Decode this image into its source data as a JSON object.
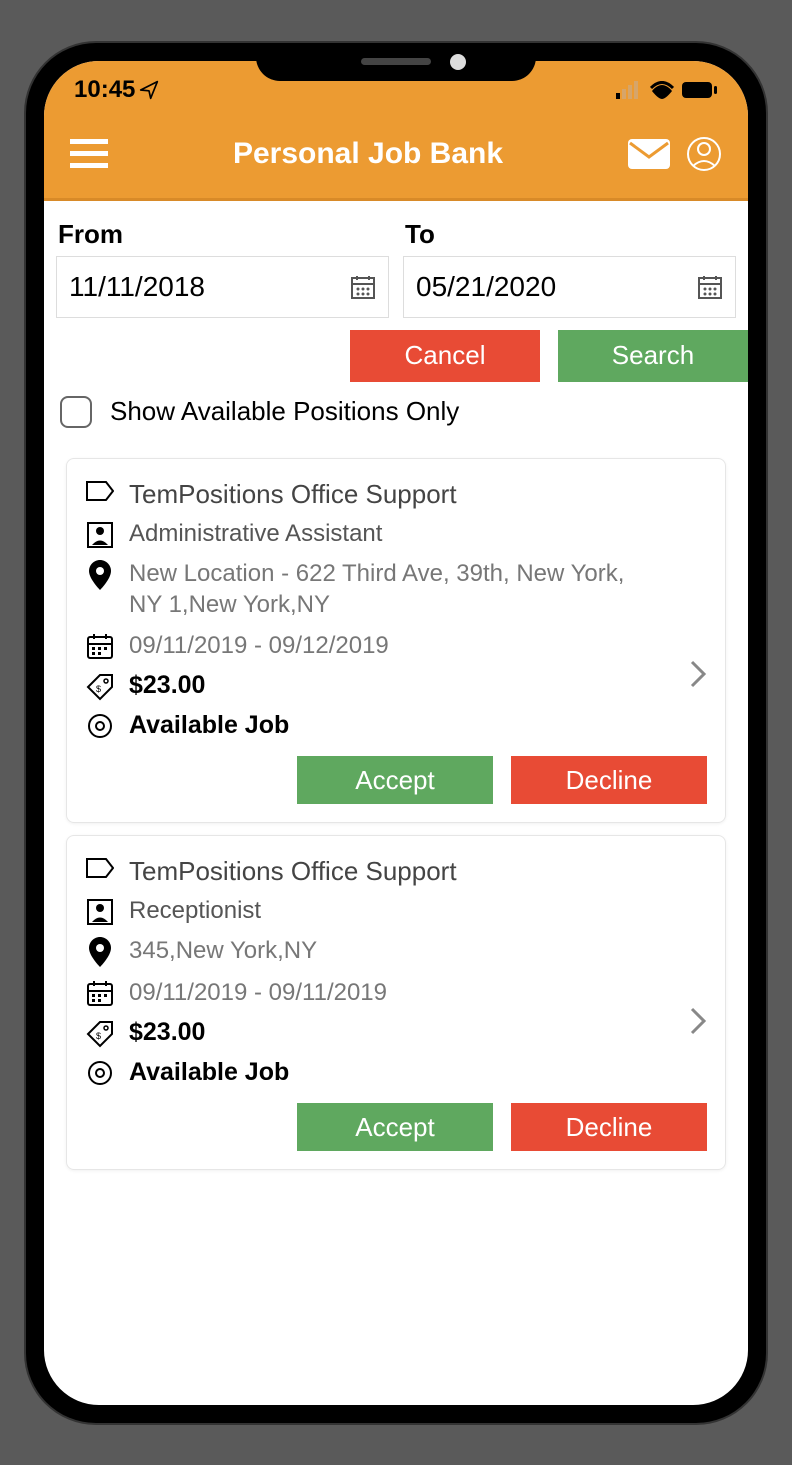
{
  "status_bar": {
    "time": "10:45"
  },
  "header": {
    "title": "Personal Job Bank"
  },
  "filter": {
    "from_label": "From",
    "from_value": "11/11/2018",
    "to_label": "To",
    "to_value": "05/21/2020",
    "cancel_label": "Cancel",
    "search_label": "Search",
    "checkbox_label": "Show Available Positions Only"
  },
  "jobs": [
    {
      "company": "TemPositions Office Support",
      "role": "Administrative Assistant",
      "location": "New Location - 622 Third Ave, 39th, New York, NY 1,New York,NY",
      "dates": "09/11/2019 - 09/12/2019",
      "rate": "$23.00",
      "status": "Available Job",
      "accept_label": "Accept",
      "decline_label": "Decline"
    },
    {
      "company": "TemPositions Office Support",
      "role": "Receptionist",
      "location": "345,New York,NY",
      "dates": "09/11/2019 - 09/11/2019",
      "rate": "$23.00",
      "status": "Available Job",
      "accept_label": "Accept",
      "decline_label": "Decline"
    }
  ]
}
